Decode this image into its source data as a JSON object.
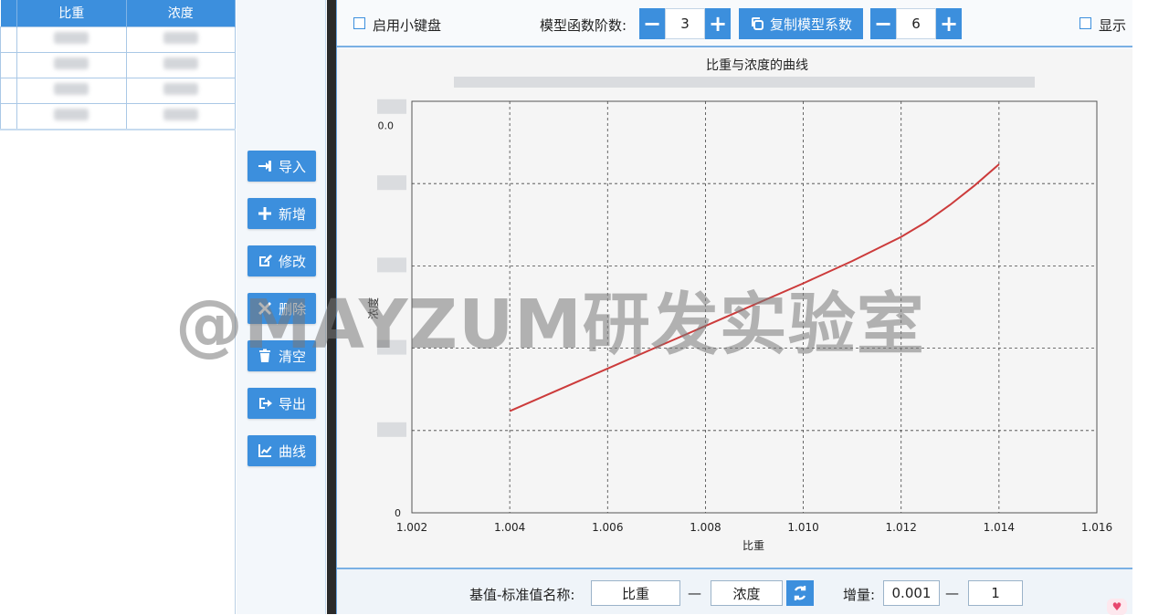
{
  "table": {
    "headers": [
      "比重",
      "浓度"
    ],
    "rows": 4
  },
  "side_buttons": [
    {
      "id": "import",
      "label": "导入",
      "icon": "import-icon"
    },
    {
      "id": "add",
      "label": "新增",
      "icon": "plus-icon"
    },
    {
      "id": "edit",
      "label": "修改",
      "icon": "edit-icon"
    },
    {
      "id": "delete",
      "label": "删除",
      "icon": "close-icon"
    },
    {
      "id": "clear",
      "label": "清空",
      "icon": "trash-icon"
    },
    {
      "id": "export",
      "label": "导出",
      "icon": "export-icon"
    },
    {
      "id": "curve",
      "label": "曲线",
      "icon": "line-chart-icon"
    }
  ],
  "toolbar": {
    "keypad_label": "启用小键盘",
    "order_label": "模型函数阶数:",
    "order_value": "3",
    "copy_label": "复制模型系数",
    "precision_value": "6",
    "show_label": "显示"
  },
  "chart_data": {
    "type": "line",
    "title": "比重与浓度的曲线",
    "xlabel": "比重",
    "ylabel": "浓度",
    "xlim": [
      1.002,
      1.016
    ],
    "x_ticks": [
      "1.002",
      "1.004",
      "1.006",
      "1.008",
      "1.010",
      "1.012",
      "1.014",
      "1.016"
    ],
    "y_ticks_visible": [
      "0",
      "0.0"
    ],
    "grid": true,
    "series": [
      {
        "name": "",
        "color": "#cc3b3b",
        "points": [
          [
            1.004,
            0.21
          ],
          [
            1.005,
            0.254
          ],
          [
            1.006,
            0.298
          ],
          [
            1.007,
            0.342
          ],
          [
            1.008,
            0.386
          ],
          [
            1.009,
            0.43
          ],
          [
            1.01,
            0.474
          ],
          [
            1.011,
            0.52
          ],
          [
            1.012,
            0.57
          ],
          [
            1.0125,
            0.6
          ],
          [
            1.013,
            0.636
          ],
          [
            1.0135,
            0.676
          ],
          [
            1.014,
            0.72
          ]
        ]
      }
    ],
    "ylim": [
      0,
      0.85
    ]
  },
  "bottom": {
    "name_label": "基值-标准值名称:",
    "base_name": "比重",
    "dash1": "—",
    "std_name": "浓度",
    "increment_label": "增量:",
    "increment_value": "0.001",
    "dash2": "—",
    "increment_value2": "1"
  },
  "watermark": "@MAYZUM研发实验室"
}
